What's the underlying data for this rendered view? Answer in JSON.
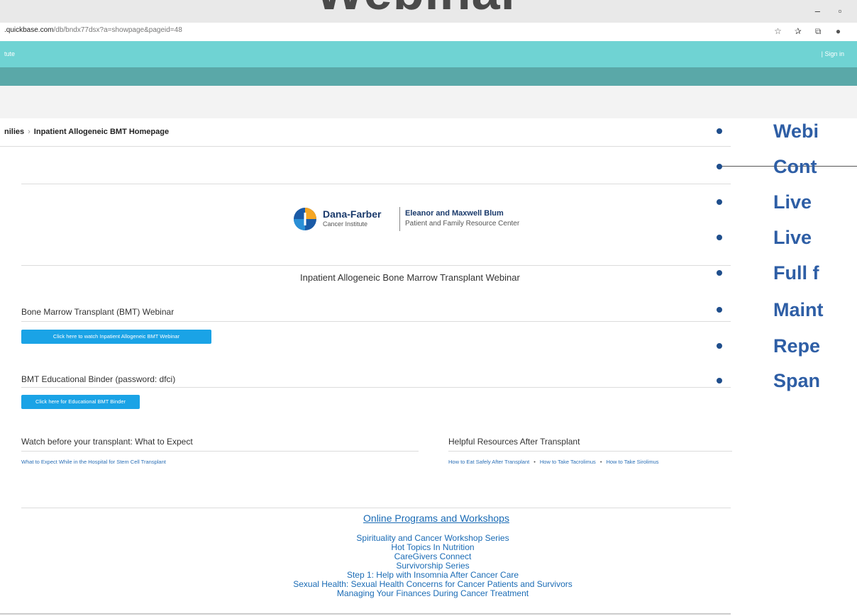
{
  "slide": {
    "title": "Webinar"
  },
  "window": {
    "minimize": "–",
    "restore": "▫"
  },
  "browser": {
    "url_domain": ".quickbase.com",
    "url_path": "/db/bndx77dsx?a=showpage&pageid=48",
    "icons": [
      "star-icon",
      "favorites-icon",
      "collections-icon",
      "profile-icon"
    ]
  },
  "appbar": {
    "left_text": "tute",
    "right_text": "| Sign in"
  },
  "breadcrumb": {
    "parent": "nilies",
    "current": "Inpatient Allogeneic BMT Homepage"
  },
  "logo": {
    "name": "Dana-Farber",
    "subname": "Cancer Institute",
    "right_line1": "Eleanor and Maxwell Blum",
    "right_line2": "Patient and Family Resource Center"
  },
  "page_heading": "Inpatient Allogeneic Bone Marrow Transplant Webinar",
  "sections": {
    "webinar": {
      "title": "Bone Marrow Transplant (BMT) Webinar",
      "button": "Click here to watch Inpatient Allogeneic BMT Webinar"
    },
    "binder": {
      "title": "BMT Educational Binder (password: dfci)",
      "button": "Click here for Educational BMT Binder"
    },
    "before": {
      "title": "Watch before your transplant: What to Expect",
      "link": "What to Expect While in the Hospital for Stem Cell Transplant"
    },
    "after": {
      "title": "Helpful Resources After Transplant",
      "links": [
        "How to Eat Safely After Transplant",
        "How to Take Tacrolimus",
        "How to Take Sirolimus"
      ],
      "separator": "•"
    }
  },
  "programs": {
    "title": "Online Programs and Workshops",
    "items": [
      "Spirituality and Cancer Workshop Series",
      "Hot Topics In Nutrition",
      "CareGivers Connect",
      "Survivorship Series",
      "Step 1: Help with Insomnia After Cancer Care",
      "Sexual Health: Sexual Health Concerns for Cancer Patients and Survivors",
      "Managing Your Finances During Cancer Treatment"
    ]
  },
  "bullets": [
    "Webi",
    "Cont",
    "Live",
    "Live",
    "Full f",
    "Maint",
    "Repe",
    "Span"
  ],
  "colors": {
    "accent": "#6fd3d3",
    "button": "#1aa3e6",
    "link": "#1a6bb5",
    "bullet_text": "#2e5ea5"
  }
}
